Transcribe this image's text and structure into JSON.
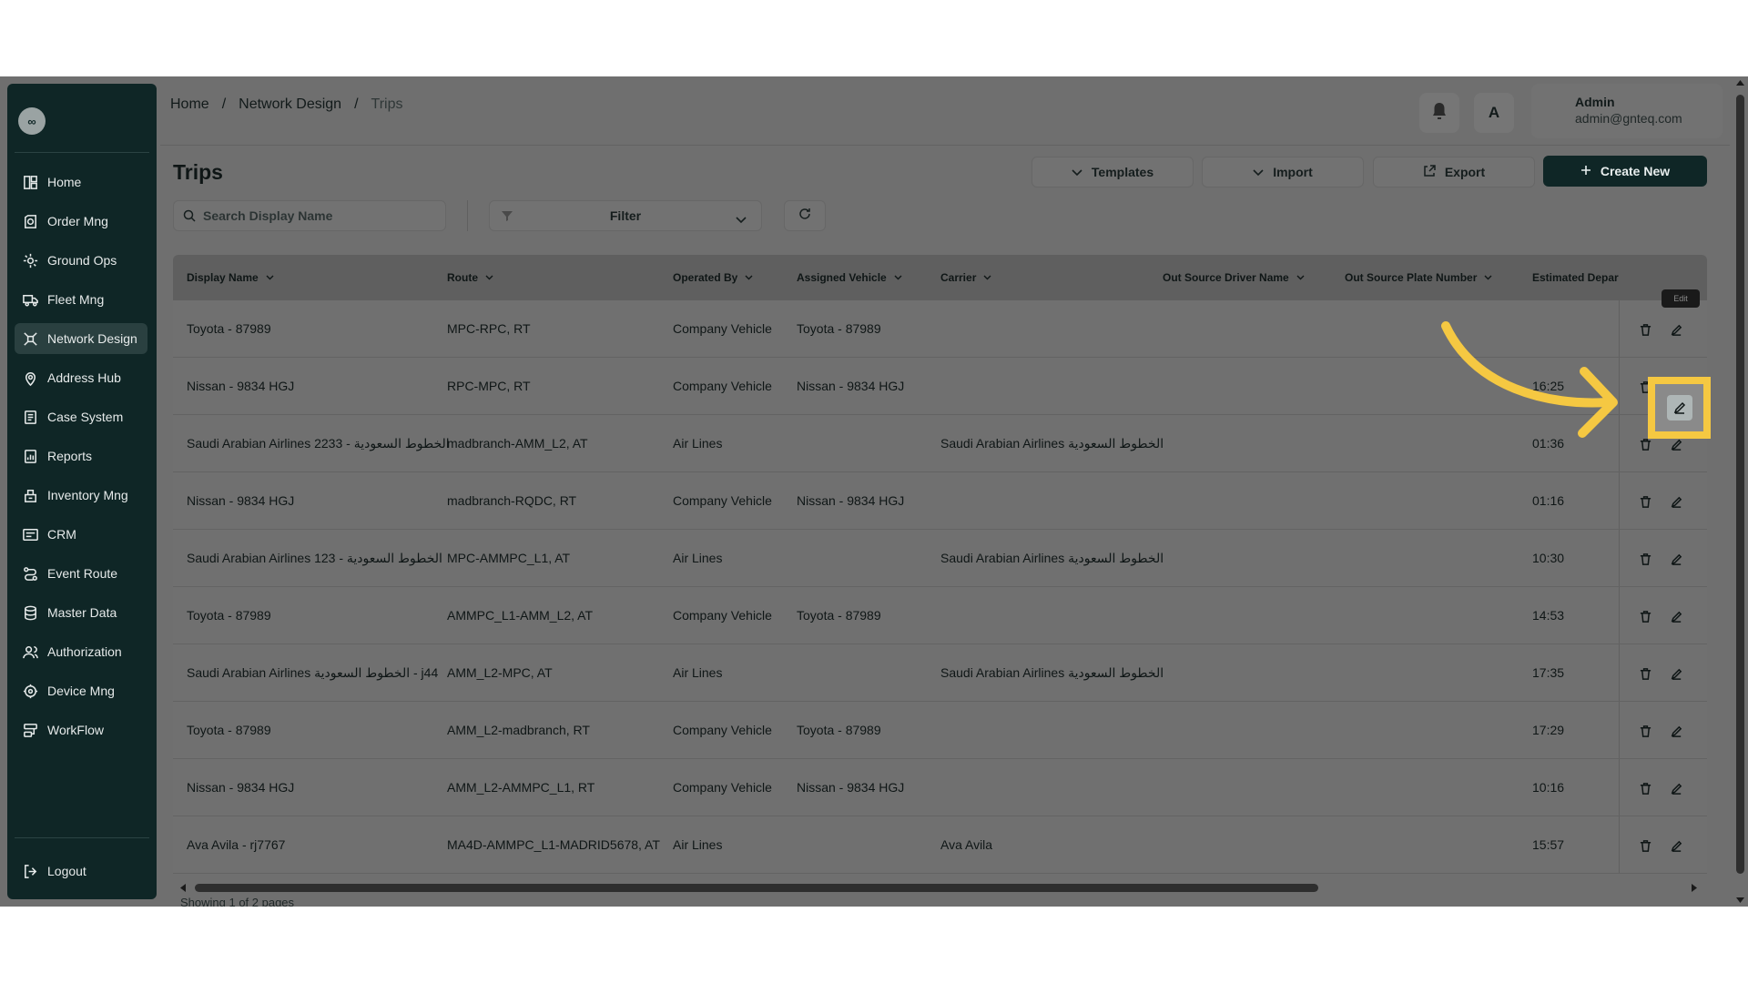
{
  "app": {
    "logo_glyph": "∞"
  },
  "sidebar": {
    "items": [
      {
        "label": "Home",
        "icon": "dashboard-icon"
      },
      {
        "label": "Order Mng",
        "icon": "order-icon"
      },
      {
        "label": "Ground Ops",
        "icon": "ground-ops-icon"
      },
      {
        "label": "Fleet Mng",
        "icon": "truck-icon"
      },
      {
        "label": "Network Design",
        "icon": "network-icon",
        "active": true
      },
      {
        "label": "Address Hub",
        "icon": "location-pin-icon"
      },
      {
        "label": "Case System",
        "icon": "case-icon"
      },
      {
        "label": "Reports",
        "icon": "report-icon"
      },
      {
        "label": "Inventory Mng",
        "icon": "inventory-icon"
      },
      {
        "label": "CRM",
        "icon": "crm-icon"
      },
      {
        "label": "Event Route",
        "icon": "route-icon"
      },
      {
        "label": "Master Data",
        "icon": "database-icon"
      },
      {
        "label": "Authorization",
        "icon": "users-icon"
      },
      {
        "label": "Device Mng",
        "icon": "device-icon"
      },
      {
        "label": "WorkFlow",
        "icon": "workflow-icon"
      }
    ],
    "logout_label": "Logout"
  },
  "breadcrumb": {
    "items": [
      "Home",
      "Network Design",
      "Trips"
    ],
    "separator": "/"
  },
  "header": {
    "lang_glyph": "A",
    "user_name": "Admin",
    "user_email": "admin@gnteq.com"
  },
  "page": {
    "title": "Trips",
    "templates_label": "Templates",
    "import_label": "Import",
    "export_label": "Export",
    "create_label": "Create New",
    "search_placeholder": "Search Display Name",
    "filter_label": "Filter"
  },
  "table": {
    "columns": [
      "Display Name",
      "Route",
      "Operated By",
      "Assigned Vehicle",
      "Carrier",
      "Out Source Driver Name",
      "Out Source Plate Number",
      "Estimated Depar"
    ],
    "rows": [
      {
        "display_name": "Toyota - 87989",
        "route": "MPC-RPC, RT",
        "operated_by": "Company Vehicle",
        "vehicle": "Toyota - 87989",
        "carrier": "",
        "est_dep": ""
      },
      {
        "display_name": "Nissan - 9834 HGJ",
        "route": "RPC-MPC, RT",
        "operated_by": "Company Vehicle",
        "vehicle": "Nissan - 9834 HGJ",
        "carrier": "",
        "est_dep": "16:25"
      },
      {
        "display_name": "Saudi Arabian Airlines 2233 - الخطوط السعودية",
        "route": "madbranch-AMM_L2, AT",
        "operated_by": "Air Lines",
        "vehicle": "",
        "carrier": "Saudi Arabian Airlines الخطوط السعودية",
        "est_dep": "01:36"
      },
      {
        "display_name": "Nissan - 9834 HGJ",
        "route": "madbranch-RQDC, RT",
        "operated_by": "Company Vehicle",
        "vehicle": "Nissan - 9834 HGJ",
        "carrier": "",
        "est_dep": "01:16"
      },
      {
        "display_name": "Saudi Arabian Airlines 123 - الخطوط السعودية",
        "route": "MPC-AMMPC_L1, AT",
        "operated_by": "Air Lines",
        "vehicle": "",
        "carrier": "Saudi Arabian Airlines الخطوط السعودية",
        "est_dep": "10:30"
      },
      {
        "display_name": "Toyota - 87989",
        "route": "AMMPC_L1-AMM_L2, AT",
        "operated_by": "Company Vehicle",
        "vehicle": "Toyota - 87989",
        "carrier": "",
        "est_dep": "14:53"
      },
      {
        "display_name": "Saudi Arabian Airlines الخطوط السعودية - j44",
        "route": "AMM_L2-MPC, AT",
        "operated_by": "Air Lines",
        "vehicle": "",
        "carrier": "Saudi Arabian Airlines الخطوط السعودية",
        "est_dep": "17:35"
      },
      {
        "display_name": "Toyota - 87989",
        "route": "AMM_L2-madbranch, RT",
        "operated_by": "Company Vehicle",
        "vehicle": "Toyota - 87989",
        "carrier": "",
        "est_dep": "17:29"
      },
      {
        "display_name": "Nissan - 9834 HGJ",
        "route": "AMM_L2-AMMPC_L1, RT",
        "operated_by": "Company Vehicle",
        "vehicle": "Nissan - 9834 HGJ",
        "carrier": "",
        "est_dep": "10:16"
      },
      {
        "display_name": "Ava Avila - rj7767",
        "route": "MA4D-AMMPC_L1-MADRID5678, AT",
        "operated_by": "Air Lines",
        "vehicle": "",
        "carrier": "Ava Avila",
        "est_dep": "15:57"
      }
    ]
  },
  "footer": {
    "pages_text": "Showing 1 of 2 pages"
  },
  "tooltip": {
    "text": "Edit"
  },
  "colors": {
    "sidebar_bg": "#0f2626",
    "accent": "#0f2626",
    "highlight": "#f5c842"
  }
}
